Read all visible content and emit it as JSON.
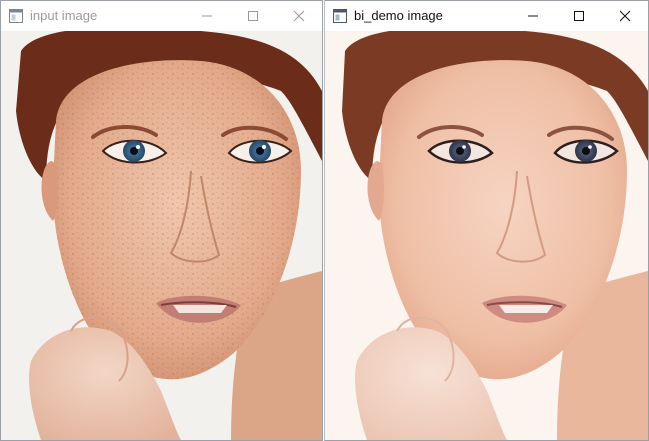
{
  "windows": [
    {
      "title": "input image",
      "active": false,
      "controls": {
        "minimize": "minimize-icon",
        "maximize": "maximize-icon",
        "close": "close-icon"
      },
      "image": {
        "subject": "portrait-freckled-face"
      }
    },
    {
      "title": "bi_demo image",
      "active": true,
      "controls": {
        "minimize": "minimize-icon",
        "maximize": "maximize-icon",
        "close": "close-icon"
      },
      "image": {
        "subject": "portrait-smoothed-face"
      }
    }
  ],
  "colors": {
    "title_inactive": "#9b9b9b",
    "title_active": "#111111",
    "window_border": "#9aa0a6",
    "skin_input": "#e8b79c",
    "skin_filtered": "#f0c2a8",
    "hair": "#6b2d1a",
    "background_left": "#f3f1ee",
    "background_right": "#fbf4ef"
  }
}
